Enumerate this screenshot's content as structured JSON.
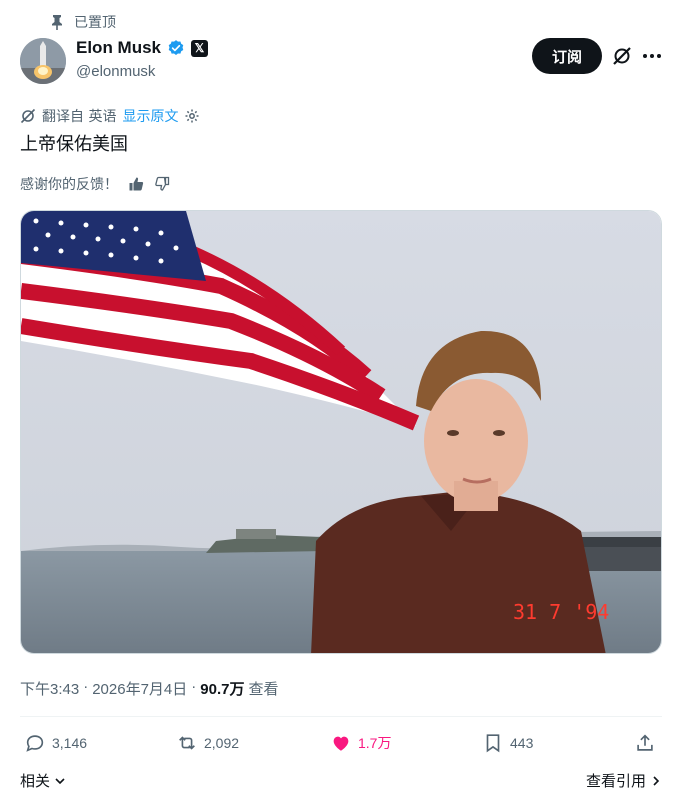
{
  "pinned_label": "已置顶",
  "author": {
    "name": "Elon Musk",
    "handle": "@elonmusk",
    "x_badge": "𝕏"
  },
  "subscribe_label": "订阅",
  "translation": {
    "translated_from": "翻译自 英语",
    "show_original": "显示原文"
  },
  "tweet_text": "上帝保佑美国",
  "feedback_prompt": "感谢你的反馈！",
  "photo_date_stamp": "31 7 '94",
  "meta": {
    "time": "下午3:43",
    "separator1": "·",
    "date": "2026年7月4日",
    "separator2": "·",
    "views_count": "90.7万",
    "views_label": "查看"
  },
  "actions": {
    "replies": "3,146",
    "reposts": "2,092",
    "likes": "1.7万",
    "bookmarks": "443"
  },
  "bottom": {
    "related": "相关",
    "view_quotes": "查看引用"
  },
  "colors": {
    "accent": "#1d9bf0",
    "like": "#f91880",
    "text": "#0f1419",
    "muted": "#536471"
  }
}
